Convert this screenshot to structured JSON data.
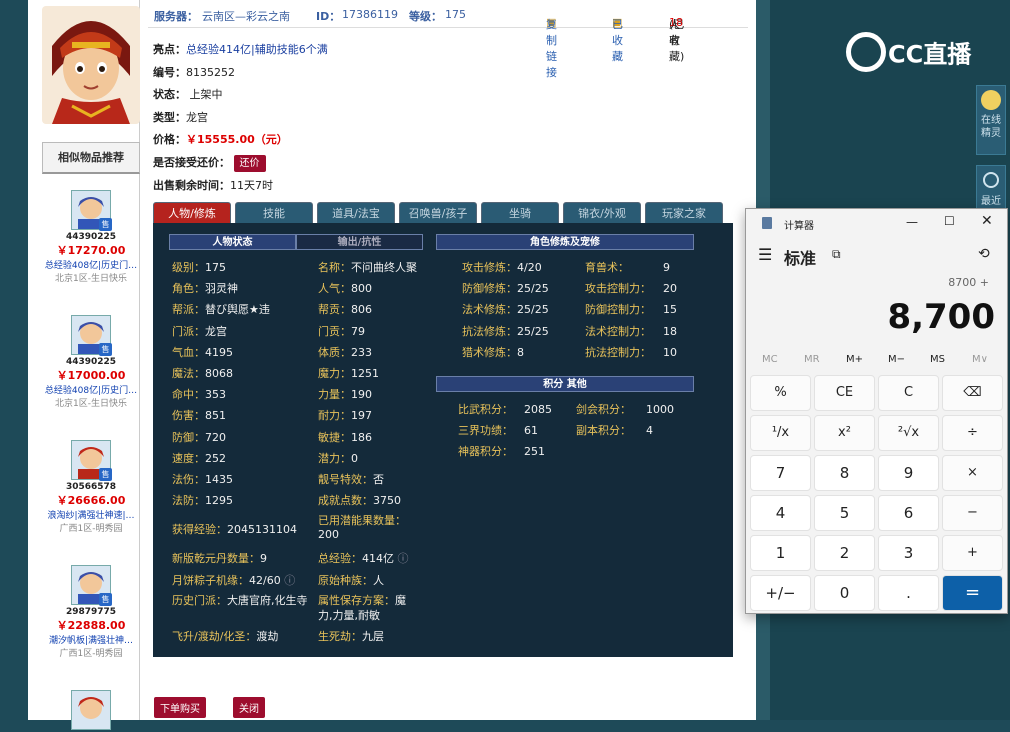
{
  "topbar": {
    "server_label": "服务器：",
    "server_value": "云南区—彩云之南",
    "id_label": "ID：",
    "id_value": "17386119",
    "level_label": "等级：",
    "level_value": "175",
    "copy_link": "复制链接",
    "favorited": "已收藏",
    "fav_count_text_pre": "(已有",
    "fav_count": "18",
    "fav_count_text_post": "人收藏)"
  },
  "info": {
    "highlight_label": "亮点：",
    "highlight_value": "总经验414亿|辅助技能6个满",
    "serial_label": "编号：",
    "serial_value": "8135252",
    "status_label": "状态：",
    "status_value": "上架中",
    "type_label": "类型：",
    "type_value": "龙宫",
    "price_label": "价格：",
    "price_value": "￥15555.00（元）",
    "bargain_label": "是否接受还价：",
    "bargain_button": "还价",
    "time_label": "出售剩余时间：",
    "time_value": "11天7时"
  },
  "similar": {
    "title": "相似物品推荐",
    "items": [
      {
        "id": "44390225",
        "price": "￥17270.00",
        "desc": "总经验408亿|历史门…",
        "server": "北京1区-生日快乐"
      },
      {
        "id": "44390225",
        "price": "￥17000.00",
        "desc": "总经验408亿|历史门…",
        "server": "北京1区-生日快乐"
      },
      {
        "id": "30566578",
        "price": "￥26666.00",
        "desc": "浪淘纱|满强壮神速|…",
        "server": "广西1区-明秀园"
      },
      {
        "id": "29879775",
        "price": "￥22888.00",
        "desc": "潮汐帆板|满强壮神…",
        "server": "广西1区-明秀园"
      }
    ],
    "tag": "售"
  },
  "tabs": [
    "人物/修炼",
    "技能",
    "道具/法宝",
    "召唤兽/孩子",
    "坐骑",
    "锦衣/外观",
    "玩家之家"
  ],
  "panel": {
    "hdr_status": "人物状态",
    "hdr_resist": "输出/抗性",
    "hdr_cult": "角色修炼及宠修",
    "hdr_points": "积分 其他",
    "left_col": [
      {
        "k": "级别：",
        "v": "175"
      },
      {
        "k": "角色：",
        "v": "羽灵神"
      },
      {
        "k": "帮派：",
        "v": "替び舆愿★违"
      },
      {
        "k": "门派：",
        "v": "龙宫"
      },
      {
        "k": "气血：",
        "v": "4195"
      },
      {
        "k": "魔法：",
        "v": "8068"
      },
      {
        "k": "命中：",
        "v": "353"
      },
      {
        "k": "伤害：",
        "v": "851"
      },
      {
        "k": "防御：",
        "v": "720"
      },
      {
        "k": "速度：",
        "v": "252"
      },
      {
        "k": "法伤：",
        "v": "1435"
      },
      {
        "k": "法防：",
        "v": "1295"
      }
    ],
    "mid_col": [
      {
        "k": "名称：",
        "v": "不问曲终人聚"
      },
      {
        "k": "人气：",
        "v": "800"
      },
      {
        "k": "帮贡：",
        "v": "806"
      },
      {
        "k": "门贡：",
        "v": "79"
      },
      {
        "k": "体质：",
        "v": "233"
      },
      {
        "k": "魔力：",
        "v": "1251"
      },
      {
        "k": "力量：",
        "v": "190"
      },
      {
        "k": "耐力：",
        "v": "197"
      },
      {
        "k": "敏捷：",
        "v": "186"
      },
      {
        "k": "潜力：",
        "v": "0"
      },
      {
        "k": "靓号特效：",
        "v": "否"
      },
      {
        "k": "成就点数：",
        "v": "3750"
      }
    ],
    "exp_label": "获得经验：",
    "exp_value": "2045131104",
    "used_pot_label": "已用潜能果数量：",
    "used_pot_value": "200",
    "qianyuan_label": "新版乾元丹数量：",
    "qianyuan_value": "9",
    "total_exp_label": "总经验：",
    "total_exp_value": "414亿",
    "zongzi_label": "月饼粽子机缘：",
    "zongzi_value": "42/60",
    "race_label": "原始种族：",
    "race_value": "人",
    "hist_label": "历史门派：",
    "hist_value": "大唐官府,化生寺",
    "attr_label": "属性保存方案：",
    "attr_value": "魔力,力量,耐敏",
    "fly_label": "飞升/渡劫/化圣：",
    "fly_value": "渡劫",
    "life_label": "生死劫：",
    "life_value": "九层",
    "cult": [
      {
        "k": "攻击修炼：",
        "v": "4/20",
        "k2": "育兽术：",
        "v2": "9"
      },
      {
        "k": "防御修炼：",
        "v": "25/25",
        "k2": "攻击控制力：",
        "v2": "20"
      },
      {
        "k": "法术修炼：",
        "v": "25/25",
        "k2": "防御控制力：",
        "v2": "15"
      },
      {
        "k": "抗法修炼：",
        "v": "25/25",
        "k2": "法术控制力：",
        "v2": "18"
      },
      {
        "k": "猎术修炼：",
        "v": "8",
        "k2": "抗法控制力：",
        "v2": "10"
      }
    ],
    "points": [
      {
        "k": "比武积分：",
        "v": "2085",
        "k2": "剑会积分：",
        "v2": "1000"
      },
      {
        "k": "三界功绩：",
        "v": "61",
        "k2": "副本积分：",
        "v2": "4"
      },
      {
        "k": "神器积分：",
        "v": "251",
        "k2": "",
        "v2": ""
      }
    ]
  },
  "bottom": {
    "buy": "下单购买",
    "close": "关闭"
  },
  "rightpanel": {
    "brand": "CC直播",
    "online_label": "在线精灵",
    "recent_label": "最近"
  },
  "calc": {
    "title": "计算器",
    "mode": "标准",
    "expression": "8700 +",
    "display": "8,700",
    "memory": [
      "MC",
      "MR",
      "M+",
      "M−",
      "MS",
      "M∨"
    ],
    "keys": [
      [
        "%",
        "CE",
        "C",
        "⌫"
      ],
      [
        "¹/x",
        "x²",
        "²√x",
        "÷"
      ],
      [
        "7",
        "8",
        "9",
        "×"
      ],
      [
        "4",
        "5",
        "6",
        "−"
      ],
      [
        "1",
        "2",
        "3",
        "+"
      ],
      [
        "+/−",
        "0",
        ".",
        "="
      ]
    ]
  }
}
